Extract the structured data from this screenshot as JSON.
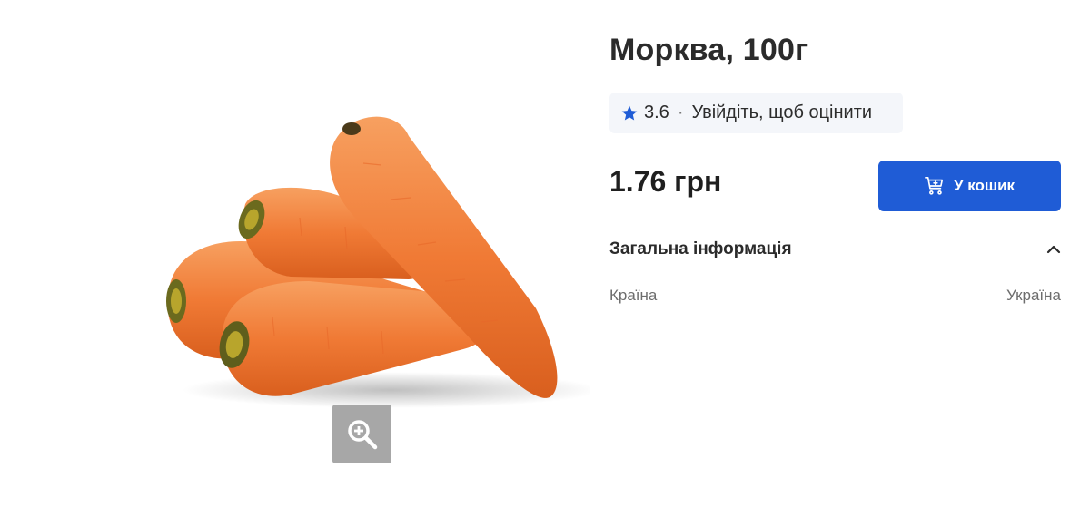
{
  "product": {
    "title": "Морква, 100г",
    "image_alt": "carrots-image",
    "price": "1.76 грн"
  },
  "rating": {
    "value": "3.6",
    "separator": "·",
    "login_text": "Увійдіть, щоб оцінити",
    "star_color": "#1f5cd6"
  },
  "cart_button": {
    "label": "У кошик",
    "icon": "cart-plus-icon",
    "color": "#1f5cd6"
  },
  "general_info": {
    "title": "Загальна інформація",
    "expanded": true,
    "rows": [
      {
        "label": "Країна",
        "value": "Україна"
      }
    ]
  },
  "zoom_button": {
    "icon": "zoom-in-icon"
  }
}
